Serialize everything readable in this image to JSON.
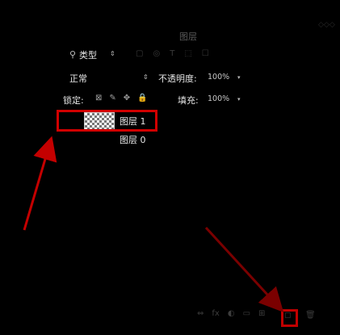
{
  "panel": {
    "title": "图层",
    "corner_icons": "◇◇◇"
  },
  "filter": {
    "search_icon": "⚲",
    "kind_label": "类型",
    "arrow": "⇕",
    "filter_icons": [
      "▢",
      "◎",
      "T",
      "⬚",
      "☐"
    ]
  },
  "blend": {
    "mode": "正常",
    "arrow": "⇕",
    "opacity_label": "不透明度:",
    "opacity_value": "100%",
    "opacity_arrow": "▾"
  },
  "lock": {
    "label": "锁定:",
    "icons": [
      "⊠",
      "✎",
      "✥",
      "🔒"
    ],
    "fill_label": "填充:",
    "fill_value": "100%",
    "fill_arrow": "▾"
  },
  "layers": [
    {
      "name": "图层 1",
      "selected": true
    },
    {
      "name": "图层 0",
      "selected": false
    }
  ],
  "bottom_icons": [
    "⇔",
    "fx",
    "◐",
    "▭",
    "⊞"
  ],
  "annotation_color": "#d10000"
}
